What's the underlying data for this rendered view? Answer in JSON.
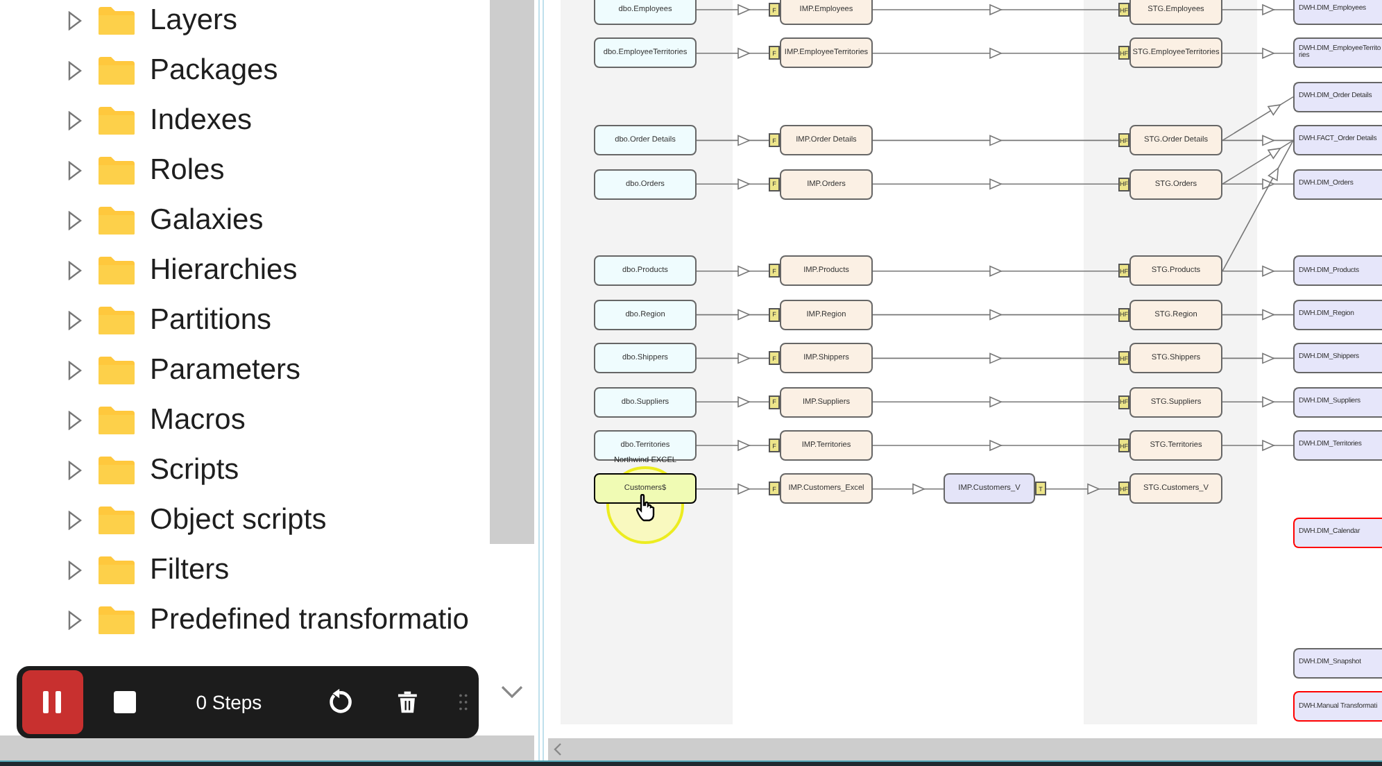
{
  "tree": {
    "items": [
      {
        "label": "Layers",
        "expanded": false
      },
      {
        "label": "Packages",
        "expanded": false
      },
      {
        "label": "Indexes",
        "expanded": false
      },
      {
        "label": "Roles",
        "expanded": false
      },
      {
        "label": "Galaxies",
        "expanded": false
      },
      {
        "label": "Hierarchies",
        "expanded": false
      },
      {
        "label": "Partitions",
        "expanded": false
      },
      {
        "label": "Parameters",
        "expanded": false
      },
      {
        "label": "Macros",
        "expanded": false
      },
      {
        "label": "Scripts",
        "expanded": false
      },
      {
        "label": "Object scripts",
        "expanded": false
      },
      {
        "label": "Filters",
        "expanded": false
      },
      {
        "label": "Predefined transformatio",
        "expanded": false
      }
    ]
  },
  "recorder": {
    "recording": true,
    "steps": "0 Steps"
  },
  "diagram": {
    "rows": [
      {
        "kind": "flow",
        "cells": [
          {
            "kind": "source",
            "label": "dbo.Employees"
          },
          {
            "kind": "import",
            "label": "IMP.Employees",
            "badge": "F"
          },
          {
            "kind": "stage",
            "label": "STG.Employees",
            "badge": "HF"
          },
          {
            "kind": "dwh",
            "label": "DWH.DIM_Employees",
            "error": false
          }
        ]
      },
      {
        "kind": "flow",
        "cells": [
          {
            "kind": "source",
            "label": "dbo.EmployeeTerritories"
          },
          {
            "kind": "import",
            "label": "IMP.EmployeeTerritories",
            "badge": "F"
          },
          {
            "kind": "stage",
            "label": "STG.EmployeeTerritories",
            "badge": "HF"
          },
          {
            "kind": "dwh",
            "label": "DWH.DIM_EmployeeTerrito ries",
            "error": false
          }
        ]
      },
      {
        "kind": "flow",
        "cells": [
          {
            "kind": "dwh",
            "label": "DWH.DIM_Order Details",
            "error": false
          }
        ]
      },
      {
        "kind": "flow",
        "cells": [
          {
            "kind": "source",
            "label": "dbo.Order Details"
          },
          {
            "kind": "import",
            "label": "IMP.Order Details",
            "badge": "F"
          },
          {
            "kind": "stage",
            "label": "STG.Order Details",
            "badge": "HF",
            "extra_links": [
              {
                "kind": "one_row_up"
              }
            ]
          },
          {
            "kind": "dwh",
            "label": "DWH.FACT_Order Details",
            "error": false
          }
        ]
      },
      {
        "kind": "flow",
        "cells": [
          {
            "kind": "source",
            "label": "dbo.Orders"
          },
          {
            "kind": "import",
            "label": "IMP.Orders",
            "badge": "F"
          },
          {
            "kind": "stage",
            "label": "STG.Orders",
            "badge": "HF",
            "extra_links": [
              {
                "kind": "one_row_up"
              }
            ]
          },
          {
            "kind": "dwh",
            "label": "DWH.DIM_Orders",
            "error": false
          }
        ]
      },
      {
        "kind": "spacer"
      },
      {
        "kind": "flow",
        "cells": [
          {
            "kind": "source",
            "label": "dbo.Products"
          },
          {
            "kind": "import",
            "label": "IMP.Products",
            "badge": "F"
          },
          {
            "kind": "stage",
            "label": "STG.Products",
            "badge": "HF",
            "extra_links": [
              {
                "kind": "three_rows_up"
              }
            ]
          },
          {
            "kind": "dwh",
            "label": "DWH.DIM_Products",
            "error": false
          }
        ]
      },
      {
        "kind": "flow",
        "cells": [
          {
            "kind": "source",
            "label": "dbo.Region"
          },
          {
            "kind": "import",
            "label": "IMP.Region",
            "badge": "F"
          },
          {
            "kind": "stage",
            "label": "STG.Region",
            "badge": "HF"
          },
          {
            "kind": "dwh",
            "label": "DWH.DIM_Region",
            "error": false
          }
        ]
      },
      {
        "kind": "flow",
        "cells": [
          {
            "kind": "source",
            "label": "dbo.Shippers"
          },
          {
            "kind": "import",
            "label": "IMP.Shippers",
            "badge": "F"
          },
          {
            "kind": "stage",
            "label": "STG.Shippers",
            "badge": "HF"
          },
          {
            "kind": "dwh",
            "label": "DWH.DIM_Shippers",
            "error": false
          }
        ]
      },
      {
        "kind": "flow",
        "cells": [
          {
            "kind": "source",
            "label": "dbo.Suppliers"
          },
          {
            "kind": "import",
            "label": "IMP.Suppliers",
            "badge": "F"
          },
          {
            "kind": "stage",
            "label": "STG.Suppliers",
            "badge": "HF"
          },
          {
            "kind": "dwh",
            "label": "DWH.DIM_Suppliers",
            "error": false
          }
        ]
      },
      {
        "kind": "flow",
        "cells": [
          {
            "kind": "source",
            "label": "dbo.Territories"
          },
          {
            "kind": "import",
            "label": "IMP.Territories",
            "badge": "F"
          },
          {
            "kind": "stage",
            "label": "STG.Territories",
            "badge": "HF"
          },
          {
            "kind": "dwh",
            "label": "DWH.DIM_Territories",
            "error": false
          }
        ]
      },
      {
        "kind": "flow",
        "cells": [
          {
            "kind": "source",
            "label": "Customers$",
            "group": "Northwind EXCEL",
            "selected": true,
            "cursor_over": true
          },
          {
            "kind": "import",
            "label": "IMP.Customers_Excel",
            "badge": "F"
          },
          {
            "kind": "view",
            "label": "IMP.Customers_V",
            "badge": "T"
          },
          {
            "kind": "stage",
            "label": "STG.Customers_V",
            "badge": "HF"
          }
        ]
      },
      {
        "kind": "flow",
        "cells": [
          {
            "kind": "dwh",
            "label": "DWH.DIM_Calendar",
            "error": true
          }
        ]
      },
      {
        "kind": "spacer"
      },
      {
        "kind": "spacer"
      },
      {
        "kind": "flow",
        "cells": [
          {
            "kind": "dwh",
            "label": "DWH.DIM_Snapshot",
            "error": false
          }
        ]
      },
      {
        "kind": "flow",
        "cells": [
          {
            "kind": "dwh",
            "label": "DWH.Manual Transformati",
            "error": true
          }
        ]
      }
    ]
  }
}
